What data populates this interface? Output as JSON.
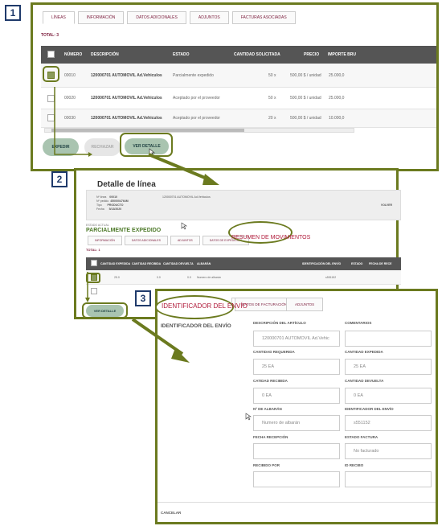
{
  "steps": [
    "1",
    "2",
    "3"
  ],
  "panel1": {
    "tabs": [
      "LÍNEAS",
      "INFORMACIÓN",
      "DATOS ADICIONALES",
      "ADJUNTOS",
      "FACTURAS ASOCIADAS"
    ],
    "total_label": "TOTAL:  3",
    "columns": [
      "NÚMERO",
      "DESCRIPCIÓN",
      "ESTADO",
      "CANTIDAD SOLICITADA",
      "PRECIO",
      "IMPORTE BRU"
    ],
    "rows": [
      {
        "numero": "00010",
        "descripcion": "120000701 AUTOMOVIL Ad.Vehiculos",
        "estado": "Parcialmente expedido",
        "cantidad": "50  x",
        "precio": "500,00 $ / unidad",
        "importe": "25.000,0",
        "checked": true
      },
      {
        "numero": "00020",
        "descripcion": "120000701 AUTOMOVIL Ad.Vehiculos",
        "estado": "Aceptado por el proveedor",
        "cantidad": "50  x",
        "precio": "500,00 $ / unidad",
        "importe": "25.000,0",
        "checked": false
      },
      {
        "numero": "00030",
        "descripcion": "120000701 AUTOMOVIL Ad.Vehiculos",
        "estado": "Aceptado por el proveedor",
        "cantidad": "20  x",
        "precio": "500,00 $ / unidad",
        "importe": "10.000,0",
        "checked": false
      }
    ],
    "buttons": {
      "expedir": "EXPEDIR",
      "rechazar": "RECHAZAR",
      "ver_detalle": "VER DETALLE"
    }
  },
  "panel2": {
    "title": "Detalle de línea",
    "info": {
      "nro_linea_label": "Nº línea",
      "nro_linea_value": "00010",
      "nro_pedido_label": "Nº pedido",
      "nro_pedido_value": "4500004764M",
      "tipo_label": "Tipo",
      "tipo_value": "PRODUCTO",
      "fecha_label": "Fecha",
      "fecha_value": "5/13/2020",
      "descripcion": "120000701 AUTOMOVIL Ad.Vehiculos",
      "volver": "VOLVER"
    },
    "estado_label": "ESTADO ACTUAL",
    "estado_value": "PARCIALMENTE EXPEDIDO",
    "tabs": [
      "INFORMACIÓN",
      "DATOS ADICIONALES",
      "ADJUNTOS",
      "DATOS DE EXPEDICIÓN"
    ],
    "resumen_label": "RESUMEN DE MOVIMIENTOS",
    "total_label": "TOTAL:  1",
    "columns": [
      "CANTIDAD EXPEDIDA",
      "CANTIDAD RECIBIDA",
      "CANTIDAD DEVUELTA",
      "ALBARÁN",
      "IDENTIFICACIÓN DEL ENVÍO",
      "ESTADO",
      "FECHA DE RECE"
    ],
    "row": {
      "expedida": "25.0",
      "recibida": "0.0",
      "devuelta": "0.0",
      "albaran": "Numero de albarán",
      "envio": "s551152"
    },
    "ver_detalle": "VER DETALLE"
  },
  "panel3": {
    "tab_active": "IDENTIFICADOR DEL ENVÍO",
    "tab_partial": "DATOS DE RECEPCIÓN",
    "tab_facturacion": "DATOS DE FACTURACIÓN",
    "tab_adjuntos": "ADJUNTOS",
    "section_title": "IDENTIFICADOR DEL ENVÍO",
    "fields": [
      {
        "label": "DESCRIPCIÓN DEL ARTÍCULO",
        "value": "120000701 AUTOMOVIL Ad.Vehic"
      },
      {
        "label": "COMENTARIOS",
        "value": ""
      },
      {
        "label": "CANTIDAD REQUERIDA",
        "value": "25 EA"
      },
      {
        "label": "CANTIDAD EXPEDIDA",
        "value": "25 EA"
      },
      {
        "label": "CATIDAD RECIBIDA",
        "value": "0 EA"
      },
      {
        "label": "CANTIDAD DEVUELTA",
        "value": "0 EA"
      },
      {
        "label": "Nº DE ALBARÁN",
        "value": "Numero de albarán"
      },
      {
        "label": "IDENTIFICADOR DEL ENVÍO",
        "value": "s551152"
      },
      {
        "label": "FECHA RECEPCIÓN",
        "value": ""
      },
      {
        "label": "ESTADO FACTURA",
        "value": "No facturado"
      },
      {
        "label": "RECIBIDO POR",
        "value": ""
      },
      {
        "label": "ID RECIBO",
        "value": ""
      }
    ],
    "cancelar": "CANCELAR"
  },
  "colors": {
    "accent": "#7a1a3a",
    "highlight": "#6b7a1f",
    "button": "#a9c4b0",
    "header": "#555555",
    "state_green": "#4e7a2a"
  },
  "icons": [
    "cursor-pointer-icon",
    "cursor-arrow-icon",
    "step-arrow-icon"
  ]
}
